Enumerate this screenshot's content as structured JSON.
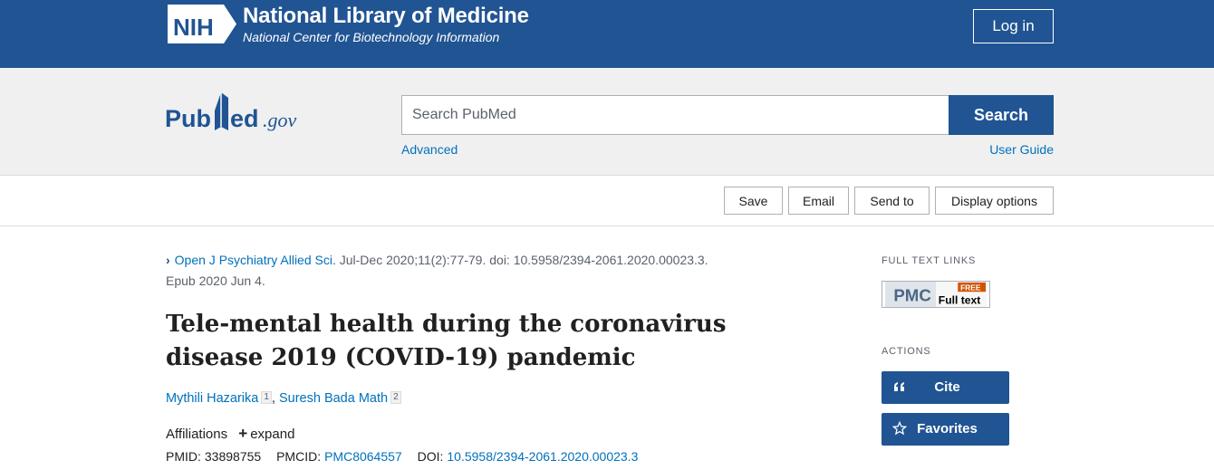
{
  "header": {
    "nih_logo_text": "NIH",
    "title": "National Library of Medicine",
    "subtitle": "National Center for Biotechnology Information",
    "login_label": "Log in"
  },
  "search": {
    "logo_text": "PubMed.gov",
    "placeholder": "Search PubMed",
    "value": "",
    "button_label": "Search",
    "advanced_label": "Advanced",
    "user_guide_label": "User Guide"
  },
  "toolbar": {
    "save_label": "Save",
    "email_label": "Email",
    "send_to_label": "Send to",
    "display_options_label": "Display options"
  },
  "article": {
    "journal": "Open J Psychiatry Allied Sci.",
    "citation_rest": " Jul-Dec 2020;11(2):77-79. doi: 10.5958/2394-2061.2020.00023.3.",
    "epub": "Epub 2020 Jun 4.",
    "title": "Tele-mental health during the coronavirus disease 2019 (COVID-19) pandemic",
    "authors": [
      {
        "name": "Mythili Hazarika",
        "aff": "1"
      },
      {
        "name": "Suresh Bada Math",
        "aff": "2"
      }
    ],
    "author_separator": ",",
    "affiliations_label": "Affiliations",
    "expand_label": "expand",
    "pmid_label": "PMID:",
    "pmid": "33898755",
    "pmcid_label": "PMCID:",
    "pmcid": "PMC8064557",
    "doi_label": "DOI:",
    "doi": "10.5958/2394-2061.2020.00023.3"
  },
  "sidebar": {
    "full_text_title": "FULL TEXT LINKS",
    "pmc_logo": "PMC",
    "pmc_free": "FREE",
    "pmc_full_text": "Full text",
    "actions_title": "ACTIONS",
    "cite_label": "Cite",
    "favorites_label": "Favorites"
  },
  "colors": {
    "brand_blue": "#205493",
    "link_blue": "#0071bc",
    "search_band_bg": "#f0f0f0"
  },
  "icons": [
    "nih-logo-icon",
    "pubmed-logo-icon",
    "chevron-right-icon",
    "plus-icon",
    "quote-icon",
    "star-icon"
  ]
}
